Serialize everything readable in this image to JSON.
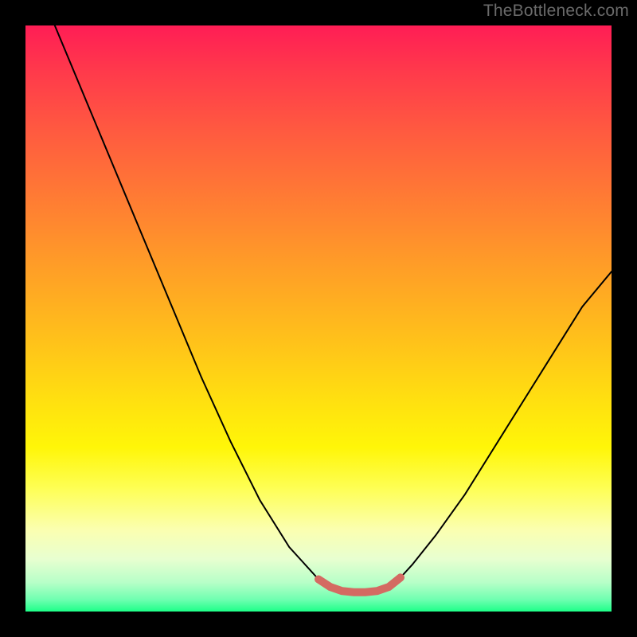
{
  "watermark": "TheBottleneck.com",
  "chart_data": {
    "type": "line",
    "title": "",
    "xlabel": "",
    "ylabel": "",
    "xlim": [
      0,
      100
    ],
    "ylim": [
      0,
      100
    ],
    "grid": false,
    "legend": false,
    "background_gradient": {
      "stops": [
        {
          "pos": 0.0,
          "color": "#ff1d55"
        },
        {
          "pos": 0.5,
          "color": "#ffc21a"
        },
        {
          "pos": 0.8,
          "color": "#feff55"
        },
        {
          "pos": 1.0,
          "color": "#1dff88"
        }
      ]
    },
    "series": [
      {
        "name": "curve",
        "color": "#000000",
        "x": [
          5.0,
          10.0,
          15.0,
          20.0,
          25.0,
          30.0,
          35.0,
          40.0,
          45.0,
          50.0,
          52.0,
          54.0,
          56.0,
          58.0,
          60.0,
          62.0,
          64.0,
          66.0,
          70.0,
          75.0,
          80.0,
          85.0,
          90.0,
          95.0,
          100.0
        ],
        "y": [
          100.0,
          88.0,
          76.0,
          64.0,
          52.0,
          40.0,
          29.0,
          19.0,
          11.0,
          5.5,
          4.2,
          3.5,
          3.3,
          3.3,
          3.5,
          4.2,
          5.8,
          8.0,
          13.0,
          20.0,
          28.0,
          36.0,
          44.0,
          52.0,
          58.0
        ]
      },
      {
        "name": "flat-marker",
        "color": "#d46a62",
        "thick": true,
        "x": [
          50.0,
          52.0,
          54.0,
          56.0,
          58.0,
          60.0,
          62.0,
          64.0
        ],
        "y": [
          5.5,
          4.2,
          3.5,
          3.3,
          3.3,
          3.5,
          4.2,
          5.8
        ]
      }
    ]
  }
}
